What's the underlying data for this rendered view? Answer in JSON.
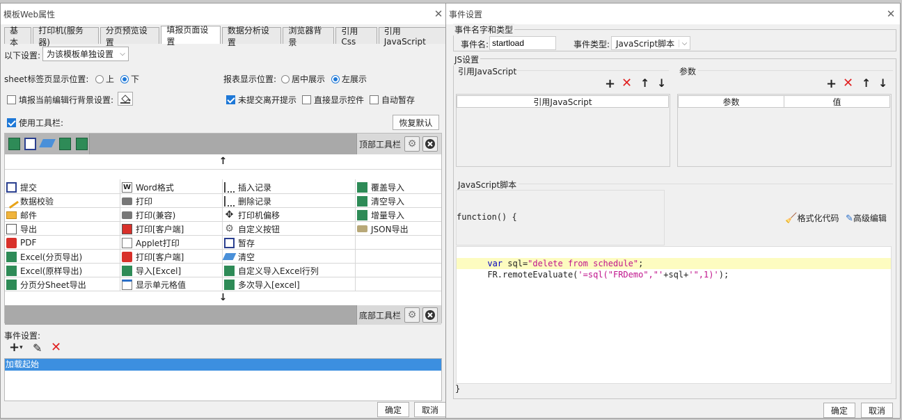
{
  "left_window": {
    "title": "模板Web属性",
    "tabs": [
      "基本",
      "打印机(服务器)",
      "分页预览设置",
      "填报页面设置",
      "数据分析设置",
      "浏览器背景",
      "引用Css",
      "引用JavaScript"
    ],
    "active_tab": 3,
    "settings_label": "以下设置:",
    "settings_value": "为该模板单独设置",
    "sheet_pos_label": "sheet标签页显示位置:",
    "sheet_top": "上",
    "sheet_bottom": "下",
    "report_pos_label": "报表显示位置:",
    "report_center": "居中展示",
    "report_left": "左展示",
    "bg_setting": "填报当前编辑行背景设置:",
    "no_submit_prompt": "未提交离开提示",
    "direct_show_ctrl": "直接显示控件",
    "auto_save": "自动暂存",
    "use_toolbar": "使用工具栏:",
    "restore_default": "恢复默认",
    "top_toolbar": "顶部工具栏",
    "bottom_toolbar": "底部工具栏",
    "up_arrow": "↑",
    "down_arrow": "↓",
    "buttons_col1": [
      "提交",
      "数据校验",
      "邮件",
      "导出",
      "PDF",
      "Excel(分页导出)",
      "Excel(原样导出)",
      "分页分Sheet导出"
    ],
    "buttons_col2": [
      "Word格式",
      "打印",
      "打印(兼容)",
      "打印[客户端]",
      "Applet打印",
      "打印[客户端]",
      "导入[Excel]",
      "显示单元格值"
    ],
    "buttons_col3": [
      "插入记录",
      "删除记录",
      "打印机偏移",
      "自定义按钮",
      "暂存",
      "清空",
      "自定义导入Excel行列",
      "多次导入[excel]"
    ],
    "buttons_col4": [
      "覆盖导入",
      "清空导入",
      "增量导入",
      "JSON导出"
    ],
    "event_label": "事件设置:",
    "event_item": "加载起始",
    "ok": "确定",
    "cancel": "取消"
  },
  "right_window": {
    "title": "事件设置",
    "name_type_group": "事件名字和类型",
    "event_name_label": "事件名:",
    "event_name_value": "startload",
    "event_type_label": "事件类型:",
    "event_type_value": "JavaScript脚本",
    "js_group": "JS设置",
    "ref_js_label": "引用JavaScript",
    "params_label": "参数",
    "ref_js_col": "引用JavaScript",
    "param_col": "参数",
    "value_col": "值",
    "js_script_label": "JavaScript脚本",
    "function_head": "function() {",
    "format_code": "格式化代码",
    "advanced_edit": "高级编辑",
    "code_line1_kw": "var",
    "code_line1_var": " sql=",
    "code_line1_str": "\"delete from schedule\"",
    "code_line1_end": ";",
    "code_line2_fn": "FR.remoteEvaluate(",
    "code_line2_str1": "'=sql(\"FRDemo\",\"'",
    "code_line2_mid": "+sql+",
    "code_line2_str2": "'\",1)'",
    "code_line2_end": ");",
    "function_tail": "}",
    "ok": "确定",
    "cancel": "取消"
  },
  "colors": {
    "accent": "#1e78d7",
    "selection": "#3c8fe0",
    "code_keyword": "#0000c0",
    "code_string": "#c0148c",
    "highlight": "#fdfcc0"
  }
}
